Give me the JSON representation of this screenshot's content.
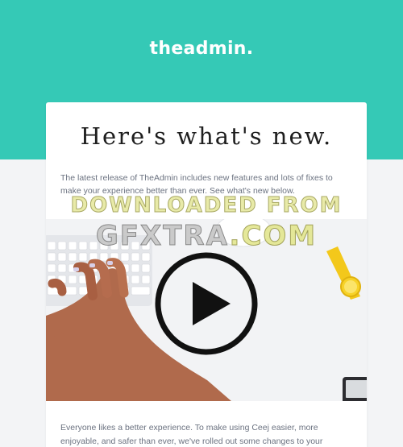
{
  "header": {
    "logo": "theadmin.",
    "background_color": "#35c9b6"
  },
  "card": {
    "headline": "Here's what's new.",
    "intro": "The latest release of TheAdmin includes new features and lots of fixes to make your experience better than ever. See what's new below.",
    "video": {
      "play_icon": "play-icon"
    },
    "body_text": "Everyone likes a better experience. To make using Ceej easier, more enjoyable, and safer than ever, we've rolled out some changes to your account. Here's"
  },
  "watermark": {
    "line1": "DOWNLOADED FROM",
    "line2_part1": "GFXTRA",
    "line2_part2": ".COM"
  }
}
